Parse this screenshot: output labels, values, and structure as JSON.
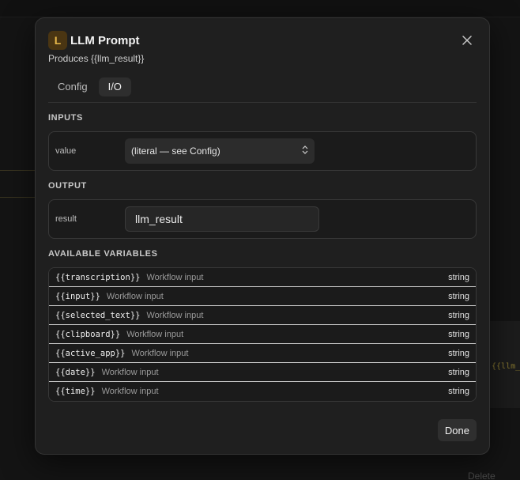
{
  "background": {
    "delete_label": "Delete",
    "var_hint": "{{llm_r"
  },
  "modal": {
    "badge_letter": "L",
    "title": "LLM Prompt",
    "subtitle": "Produces {{llm_result}}",
    "close_icon": "close-icon",
    "tabs": [
      {
        "label": "Config",
        "active": false
      },
      {
        "label": "I/O",
        "active": true
      }
    ],
    "inputs": {
      "section_label": "INPUTS",
      "field_label": "value",
      "selected_value": "(literal — see Config)"
    },
    "output": {
      "section_label": "OUTPUT",
      "field_label": "result",
      "value": "llm_result"
    },
    "variables": {
      "section_label": "AVAILABLE VARIABLES",
      "items": [
        {
          "name": "{{transcription}}",
          "source": "Workflow input",
          "type": "string"
        },
        {
          "name": "{{input}}",
          "source": "Workflow input",
          "type": "string"
        },
        {
          "name": "{{selected_text}}",
          "source": "Workflow input",
          "type": "string"
        },
        {
          "name": "{{clipboard}}",
          "source": "Workflow input",
          "type": "string"
        },
        {
          "name": "{{active_app}}",
          "source": "Workflow input",
          "type": "string"
        },
        {
          "name": "{{date}}",
          "source": "Workflow input",
          "type": "string"
        },
        {
          "name": "{{time}}",
          "source": "Workflow input",
          "type": "string"
        }
      ]
    },
    "done_label": "Done"
  },
  "colors": {
    "badge_bg": "#4a3512",
    "badge_fg": "#e8b84a",
    "modal_bg": "#1f1f1f"
  }
}
